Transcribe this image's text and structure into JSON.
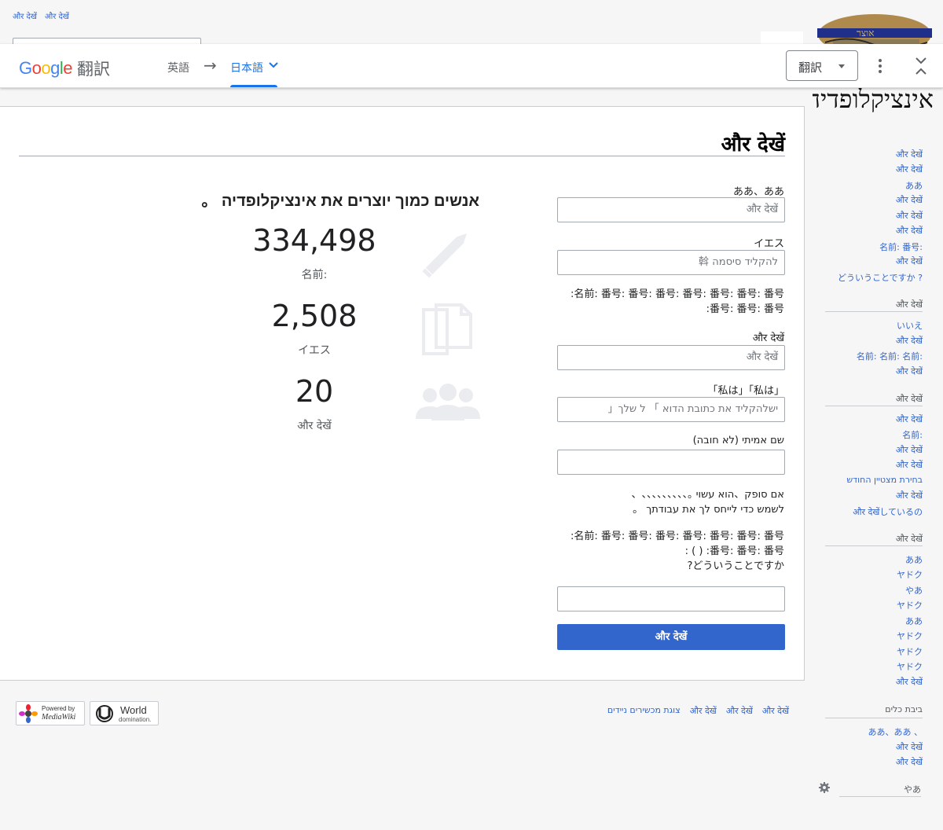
{
  "top_links": [
    "और देखें",
    "और देखें"
  ],
  "logo": {
    "wordmark": "אינציקלופדיה"
  },
  "translate_bar": {
    "brand": "Google",
    "title": "翻訳",
    "source_lang": "英語",
    "arrow": "→",
    "target_lang": "日本語",
    "dropdown_label": "翻訳",
    "colors": {
      "active": "#1a73e8"
    }
  },
  "page": {
    "title": "और देखें",
    "form": {
      "field1_label": "ああ、ああ",
      "field1_placeholder": "और देखें",
      "field2_label": "イエス",
      "field2_placeholder": "להקליד סיסמה 斡",
      "hint1_line1": "名前: 番号: 番号: 番号: 番号: 番号: 番号: 番号:",
      "hint1_line2": "番号: 番号: 番号:",
      "field3_label": "और देखें",
      "field3_placeholder": "और देखें",
      "field4_label": "「私は」「私は」",
      "field4_placeholder": "ישלהקליד את כתובת הדוא 」 ל שלך「",
      "field5_label": "שם אמיתי (לא חובה)",
      "field5_value": "",
      "para_line1": "אם סופק、הוא עשוי 。、、、、、、、、、、",
      "para_line2": "לשמש כדי לייחס לך את עבודתך 。",
      "hint2_line1": "名前: 番号: 番号: 番号: 番号: 番号: 番号: 番号:",
      "hint2_line2": "番号: 番号: 番号: ( ) :",
      "hint2_line3": "どういうことですか?",
      "field6_value": "",
      "submit_label": "और देखें"
    },
    "promo": {
      "heading": "אנשים כמוך יוצרים את אינציקלופדיה 。",
      "stats": [
        {
          "number": "334,498",
          "label": "名前:",
          "icon": "pencil-icon"
        },
        {
          "number": "2,508",
          "label": "イエス",
          "icon": "pages-icon"
        },
        {
          "number": "20",
          "label": "और देखें",
          "icon": "users-icon"
        }
      ]
    }
  },
  "sidebar": {
    "group1": [
      "और देखें",
      "और देखें",
      "ああ",
      "और देखें",
      "और देखें",
      "और देखें",
      "名前: 番号:",
      "और देखें",
      "どういうことですか ?"
    ],
    "group2_heading": "और देखें",
    "group2": [
      "いいえ",
      "और देखें",
      "名前: 名前: 名前:",
      "और देखें"
    ],
    "group3_heading": "और देखें",
    "group3": [
      "और देखें",
      "名前:",
      "और देखें",
      "और देखें",
      "בחירת מצטיין החודש",
      "और देखें",
      "और देखेंしているの"
    ],
    "group4_heading": "और देखें",
    "group4": [
      "ああ",
      "ヤドク",
      "やあ",
      "ヤドク",
      "ああ",
      "ヤドク",
      "ヤドク",
      "ヤドク",
      "और देखें"
    ],
    "group5_heading": "ביבת כלים",
    "group5": [
      "ああ、ああ 、",
      "और देखें",
      "और देखें"
    ],
    "lang_settings": "やあ"
  },
  "footer": {
    "links": [
      "और देखें",
      "और देखें",
      "और देखें",
      "צוגת מכשירים ניידים"
    ],
    "badge_mediawiki_line1": "Powered by",
    "badge_mediawiki_line2": "MediaWiki",
    "badge_world_line1": "World",
    "badge_world_line2": "domination."
  }
}
